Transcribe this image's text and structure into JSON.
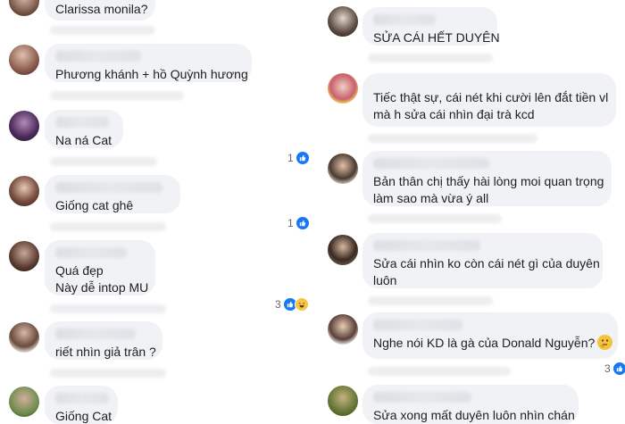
{
  "left_comments": [
    {
      "text_lines": [
        "Clarissa monila?"
      ],
      "reaction_count": null
    },
    {
      "text_lines": [
        "Phương khánh + hồ Quỳnh hương"
      ],
      "reaction_count": null
    },
    {
      "text_lines": [
        "Na ná Cat"
      ],
      "reaction_count": "1"
    },
    {
      "text_lines": [
        "Giống cat ghê"
      ],
      "reaction_count": "1"
    },
    {
      "text_lines": [
        "Quá đẹp",
        "Này dễ intop MU"
      ],
      "reaction_count": "3"
    },
    {
      "text_lines": [
        "riết nhìn giả trân ?"
      ],
      "reaction_count": null
    },
    {
      "text_lines": [
        "Giống Cat"
      ],
      "reaction_count": null
    }
  ],
  "right_comments": [
    {
      "text_lines": [
        "SỬA CÁI HẾT DUYÊN"
      ],
      "reaction_count": null
    },
    {
      "text_lines": [
        "Tiếc thật sự, cái nét khi cười lên đắt tiền vl",
        "mà h sửa cái nhìn đại trà kcd"
      ],
      "reaction_count": null
    },
    {
      "text_lines": [
        "Bản thân chị thấy hài lòng moi quan trọng",
        "làm sao mà vừa ý all"
      ],
      "reaction_count": null
    },
    {
      "text_lines": [
        "Sửa cái nhìn ko còn cái nét gì của duyên",
        "luôn"
      ],
      "reaction_count": null
    },
    {
      "text_lines": [
        "Nghe nói KD là gà của Donald Nguyễn?"
      ],
      "reaction_count": "3"
    },
    {
      "text_lines": [
        "Sửa xong mất duyên luôn nhìn chán"
      ],
      "reaction_count": null
    }
  ],
  "icons": {
    "like": "thumbs-up-icon",
    "haha": "laughing-emoji-icon",
    "thinking": "thinking-face-emoji"
  },
  "colors": {
    "bubble": "#f0f2f5",
    "like": "#1877f2",
    "text": "#1c1e21"
  }
}
